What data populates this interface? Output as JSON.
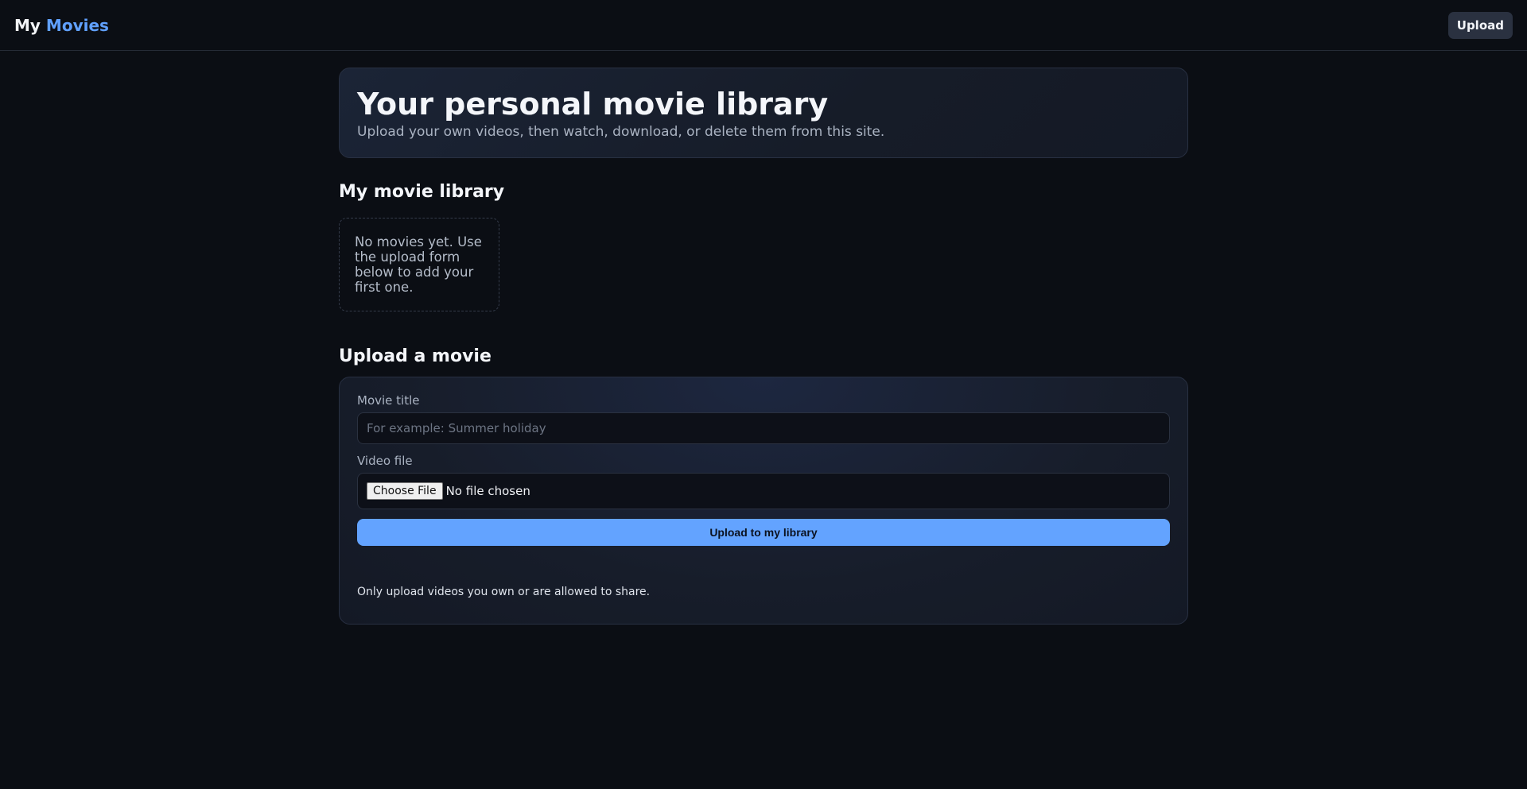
{
  "header": {
    "brand_prefix": "My",
    "brand_accent": "Movies",
    "upload_label": "Upload"
  },
  "hero": {
    "title": "Your personal movie library",
    "subtitle": "Upload your own videos, then watch, download, or delete them from this site."
  },
  "library": {
    "title": "My movie library",
    "empty_message": "No movies yet. Use the upload form below to add your first one."
  },
  "upload": {
    "title": "Upload a movie",
    "movie_title_label": "Movie title",
    "movie_title_value": "",
    "movie_title_placeholder": "For example: Summer holiday",
    "video_file_label": "Video file",
    "choose_file_label": "Choose File",
    "file_status": "No file chosen",
    "submit_label": "Upload to my library",
    "note": "Only upload videos you own or are allowed to share."
  },
  "colors": {
    "background": "#0b0e14",
    "accent": "#60a0ff",
    "submit": "#63a3ff"
  }
}
